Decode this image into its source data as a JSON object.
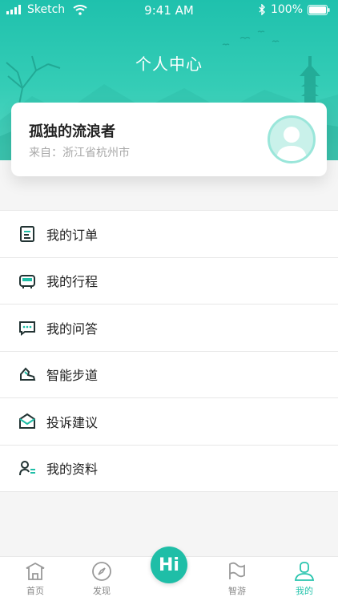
{
  "status": {
    "carrier": "Sketch",
    "time": "9:41 AM",
    "battery": "100%",
    "icons": [
      "signal-icon",
      "wifi-icon",
      "bluetooth-icon",
      "battery-icon"
    ]
  },
  "header": {
    "title": "个人中心"
  },
  "profile": {
    "name": "孤独的流浪者",
    "location": "来自：浙江省杭州市"
  },
  "menu": {
    "items": [
      {
        "label": "我的订单",
        "icon": "receipt-icon"
      },
      {
        "label": "我的行程",
        "icon": "bus-icon"
      },
      {
        "label": "我的问答",
        "icon": "chat-bubble-icon"
      },
      {
        "label": "智能步道",
        "icon": "shoe-icon"
      },
      {
        "label": "投诉建议",
        "icon": "envelope-icon"
      },
      {
        "label": "我的资料",
        "icon": "profile-list-icon"
      }
    ]
  },
  "tabbar": {
    "tabs": [
      {
        "label": "首页",
        "icon": "home-icon"
      },
      {
        "label": "发现",
        "icon": "compass-icon"
      },
      {
        "label": "Hi",
        "icon": "hi-chat-icon"
      },
      {
        "label": "智游",
        "icon": "flag-icon"
      },
      {
        "label": "我的",
        "icon": "user-icon"
      }
    ],
    "active": "我的"
  },
  "colors": {
    "accent": "#27c4ad",
    "header": "#1fc1ad",
    "text": "#222222",
    "muted": "#a8a8a8"
  }
}
